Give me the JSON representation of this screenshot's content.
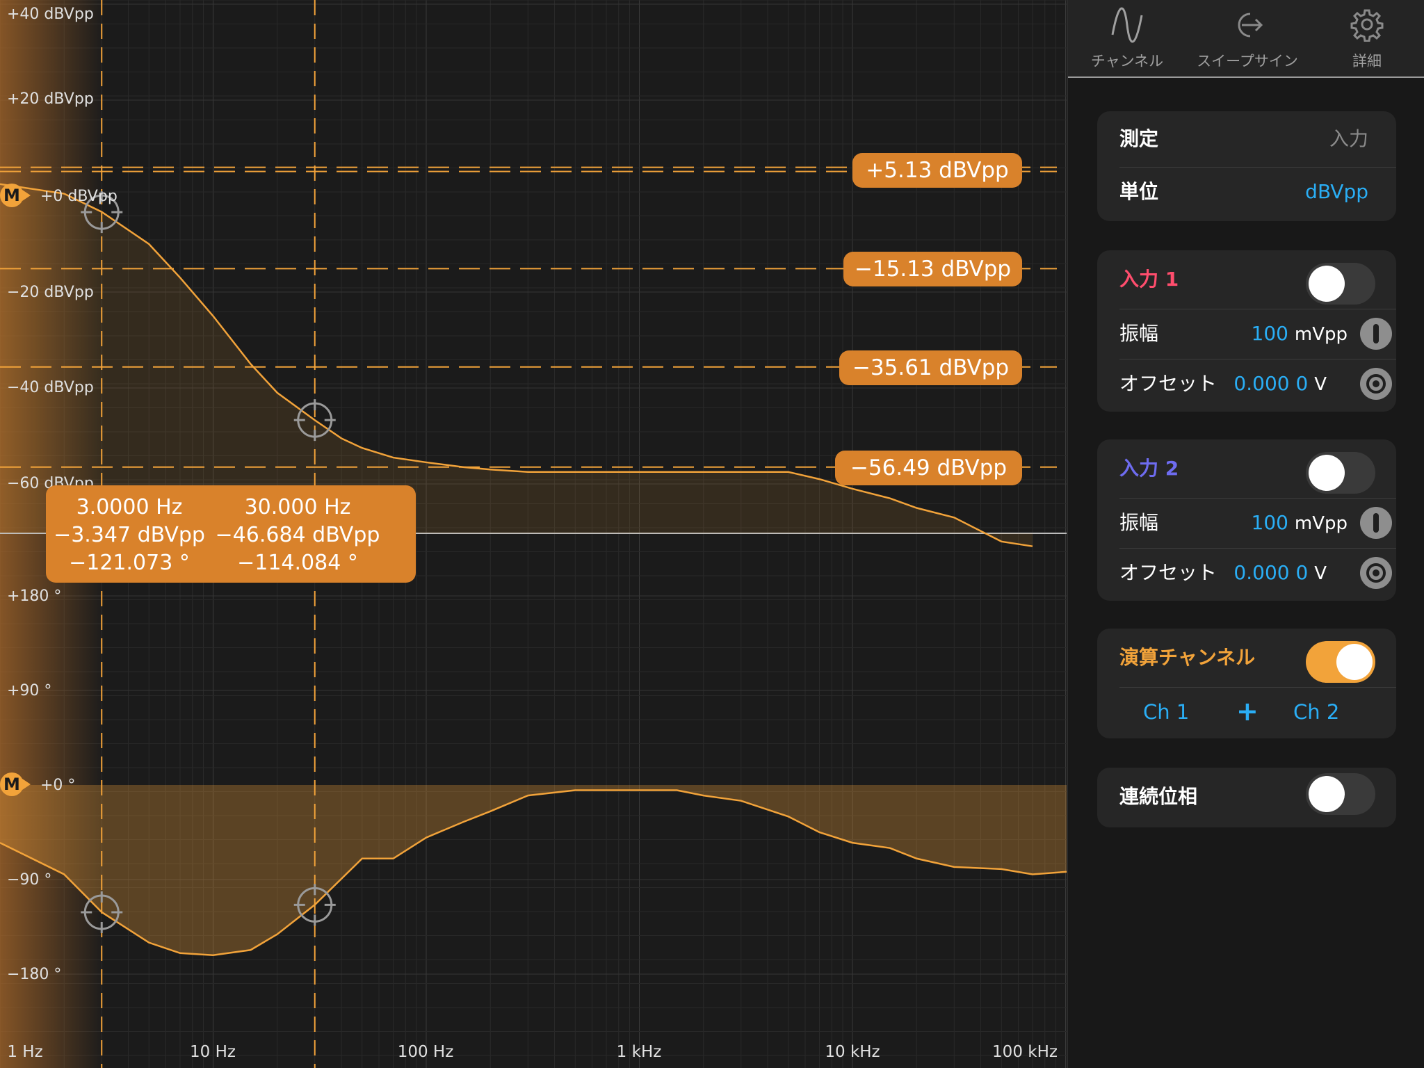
{
  "plot": {
    "magnitude_labels": [
      "+40 dBVpp",
      "+20 dBVpp",
      "−20 dBVpp",
      "−40 dBVpp",
      "−60 dBVpp"
    ],
    "phase_labels": [
      "+180 °",
      "+90 °",
      "−90 °",
      "−180 °"
    ],
    "marker": {
      "badge": "M",
      "magnitude_ref": "+0 dBVpp",
      "phase_ref": "+0 °"
    },
    "freq_labels": [
      "1 Hz",
      "10 Hz",
      "100 Hz",
      "1 kHz",
      "10 kHz",
      "100 kHz"
    ],
    "level_badges": [
      "+5.13 dBVpp",
      "−15.13 dBVpp",
      "−35.61 dBVpp",
      "−56.49 dBVpp"
    ],
    "cursor_readouts": [
      {
        "freq": "3.0000 Hz",
        "mag": "−3.347 dBVpp",
        "phase": "−121.073 °"
      },
      {
        "freq": "30.000 Hz",
        "mag": "−46.684 dBVpp",
        "phase": "−114.084 °"
      }
    ],
    "trace_color": "#f2a33a",
    "badge_color": "#d9822b"
  },
  "chart_data": {
    "type": "line",
    "x_scale": "log",
    "x_unit": "Hz",
    "xlim": [
      1,
      150000
    ],
    "panels": [
      {
        "ylabel_unit": "dBVpp",
        "ylim": [
          -80,
          40
        ],
        "series": [
          {
            "x": [
              1,
              2,
              3,
              5,
              7,
              10,
              15,
              20,
              30,
              40,
              50,
              70,
              100,
              150,
              200,
              300,
              500,
              700,
              1000,
              1500,
              2000,
              3000,
              5000,
              7000,
              10000,
              15000,
              20000,
              30000,
              50000,
              70000
            ],
            "values": [
              2.5,
              0.5,
              -3.3,
              -10,
              -17,
              -25,
              -35,
              -41,
              -46.7,
              -50.5,
              -52.5,
              -54.5,
              -55.5,
              -56.5,
              -57,
              -57.5,
              -57.5,
              -57.5,
              -57.5,
              -57.5,
              -57.5,
              -57.5,
              -57.5,
              -59,
              -61,
              -63,
              -65,
              -67,
              -72,
              -73
            ]
          }
        ]
      },
      {
        "ylabel_unit": "°",
        "ylim": [
          -200,
          200
        ],
        "series": [
          {
            "x": [
              1,
              2,
              3,
              5,
              7,
              10,
              15,
              20,
              30,
              50,
              70,
              100,
              150,
              200,
              300,
              500,
              700,
              1000,
              1500,
              2000,
              3000,
              5000,
              7000,
              10000,
              15000,
              20000,
              30000,
              50000,
              70000,
              150000
            ],
            "values": [
              -55,
              -85,
              -121,
              -150,
              -160,
              -162,
              -157,
              -142,
              -114,
              -70,
              -70,
              -50,
              -35,
              -25,
              -10,
              -5,
              -5,
              -5,
              -5,
              -10,
              -15,
              -30,
              -45,
              -55,
              -60,
              -70,
              -78,
              -80,
              -85,
              -80
            ]
          }
        ]
      }
    ],
    "cursors": [
      {
        "x": 3,
        "magnitude": -3.347,
        "phase": -121.073
      },
      {
        "x": 30,
        "magnitude": -46.684,
        "phase": -114.084
      }
    ],
    "levels": [
      5.13,
      -15.13,
      -35.61,
      -56.49
    ]
  },
  "sidebar": {
    "tabs": [
      {
        "label": "チャンネル",
        "icon": "sine-wave-icon"
      },
      {
        "label": "スイープサイン",
        "icon": "sweep-export-icon"
      },
      {
        "label": "詳細",
        "icon": "gear-icon"
      }
    ],
    "measurement": {
      "label": "測定",
      "value": "入力",
      "unit_label": "単位",
      "unit_value": "dBVpp"
    },
    "input1": {
      "title": "入力 1",
      "title_color": "#ff4d6d",
      "enabled": false,
      "amp_label": "振幅",
      "amp_value": "100",
      "amp_unit": "mVpp",
      "offset_label": "オフセット",
      "offset_value": "0.000 0",
      "offset_unit": "V"
    },
    "input2": {
      "title": "入力 2",
      "title_color": "#6e6cf0",
      "enabled": false,
      "amp_label": "振幅",
      "amp_value": "100",
      "amp_unit": "mVpp",
      "offset_label": "オフセット",
      "offset_value": "0.000 0",
      "offset_unit": "V"
    },
    "math": {
      "title": "演算チャンネル",
      "enabled": true,
      "ch_a": "Ch 1",
      "op": "+",
      "ch_b": "Ch 2"
    },
    "continuous_phase": {
      "label": "連続位相",
      "enabled": false
    },
    "accent_blue": "#2aaef5",
    "accent_orange": "#f2a33a"
  }
}
